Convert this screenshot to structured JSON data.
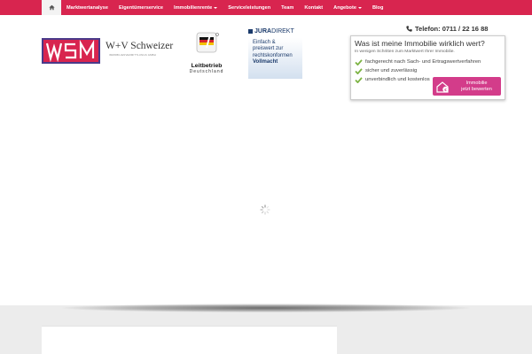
{
  "nav": {
    "home_icon": "home-icon",
    "items": [
      {
        "label": "Marktwertanalyse",
        "dropdown": false
      },
      {
        "label": "Eigentümerservice",
        "dropdown": false
      },
      {
        "label": "Immobilienrente",
        "dropdown": true
      },
      {
        "label": "Serviceleistungen",
        "dropdown": false
      },
      {
        "label": "Team",
        "dropdown": false
      },
      {
        "label": "Kontakt",
        "dropdown": false
      },
      {
        "label": "Angebote",
        "dropdown": true
      },
      {
        "label": "Blog",
        "dropdown": false
      }
    ]
  },
  "header": {
    "phone_icon": "phone-icon",
    "phone": "Telefon: 0711 / 22 16 88"
  },
  "logos": {
    "wv": {
      "name": "W+V Schweizer",
      "sub": "IMMOBILIENVERMITTLUNGS GMBH"
    },
    "leitbetrieb": {
      "title": "Leitbetrieb",
      "sub": "Deutschland"
    },
    "jura": {
      "brand_a": "JURA",
      "brand_b": "DIREKT",
      "lines": [
        "Einfach &",
        "preiswert zur",
        "rechtskonformen"
      ],
      "strong": "Vollmacht"
    }
  },
  "valuation": {
    "title": "Was ist meine Immobilie wirklich wert?",
    "subtitle": "In wenigen Schritten zum Marktwert Ihrer Immobilie.",
    "features": [
      "fachgerecht nach Sach- und Ertragswertverfahren",
      "sicher und zuverlässig",
      "unverbindlich und kostenlos"
    ],
    "cta_line1": "Immobilie",
    "cta_line2": "jetzt bewerten",
    "colors": {
      "cta": "#d33c8a",
      "check": "#7cb342"
    }
  },
  "colors": {
    "nav": "#d8254f",
    "band": "#ececec"
  }
}
